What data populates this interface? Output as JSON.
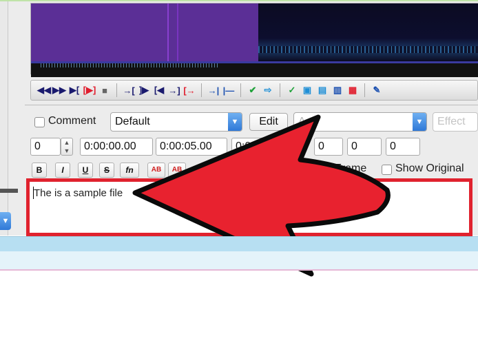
{
  "editor": {
    "comment_label": "Comment",
    "style_value": "Default",
    "edit_label": "Edit",
    "actor_value": "A",
    "effect_placeholder": "Effect",
    "layer_value": "0",
    "start_time": "0:00:00.00",
    "end_time": "0:00:05.00",
    "duration": "0:0",
    "margin_left": "0",
    "margin_right": "0",
    "margin_vertical": "0",
    "format_buttons": {
      "bold": "B",
      "italic": "I",
      "underline": "U",
      "strike": "S",
      "fn": "fn",
      "ab1": "AB",
      "ab2": "AB"
    },
    "time_label_fragment": "e",
    "frame_label": "Frame",
    "show_original_label": "Show Original",
    "subtitle_text": "The is a sample file"
  },
  "toolbar": {
    "icons": [
      "rewind-icon",
      "fast-forward-icon",
      "play-selection-icon",
      "play-selection-red-icon",
      "stop-icon",
      "play-before-icon",
      "play-begin-icon",
      "play-end-icon",
      "play-after-icon",
      "play-to-end-icon",
      "set-start-icon",
      "set-end-icon",
      "commit-icon",
      "next-line-icon",
      "auto-commit-icon",
      "auto-next-icon",
      "auto-scroll-icon",
      "spectrum-icon",
      "video-icon",
      "karaoke-icon"
    ]
  },
  "colors": {
    "highlight_red": "#e0222e",
    "selection_purple": "#5b2f96",
    "dropdown_blue": "#2f79d8"
  }
}
